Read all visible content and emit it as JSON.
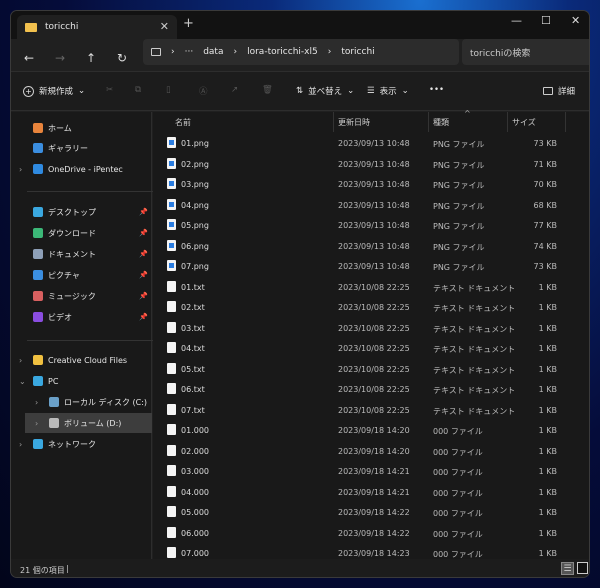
{
  "window": {
    "tab_title": "toricchi",
    "close_tab": "✕",
    "new_tab": "+",
    "minimize": "—",
    "maximize": "☐",
    "close": "✕"
  },
  "nav": {
    "back": "←",
    "forward": "→",
    "up": "↑",
    "refresh": "↻",
    "breadcrumb": [
      "data",
      "lora-toricchi-xl5",
      "toricchi"
    ],
    "more": "···",
    "sep": "›",
    "search_placeholder": "toricchiの検索"
  },
  "toolbar": {
    "new": "新規作成",
    "sort": "並べ替え",
    "view": "表示",
    "more": "•••",
    "details": "詳細"
  },
  "sidebar": {
    "quick": [
      {
        "label": "ホーム",
        "color": "#e8843c"
      },
      {
        "label": "ギャラリー",
        "color": "#3b8ee0"
      },
      {
        "label": "OneDrive - iPentec",
        "color": "#2f8ae0",
        "chev": true
      }
    ],
    "pinned": [
      {
        "label": "デスクトップ",
        "color": "#3aa8e0"
      },
      {
        "label": "ダウンロード",
        "color": "#3cb878"
      },
      {
        "label": "ドキュメント",
        "color": "#8ea0b8"
      },
      {
        "label": "ピクチャ",
        "color": "#3b8ee0"
      },
      {
        "label": "ミュージック",
        "color": "#d86060"
      },
      {
        "label": "ビデオ",
        "color": "#8a4de0"
      }
    ],
    "drives": [
      {
        "label": "Creative Cloud Files",
        "color": "#f0c040",
        "chev": "›",
        "indent": 0
      },
      {
        "label": "PC",
        "color": "#3aa8e0",
        "chev": "⌄",
        "indent": 0
      },
      {
        "label": "ローカル ディスク (C:)",
        "color": "#6aa0c8",
        "chev": "›",
        "indent": 1
      },
      {
        "label": "ボリューム (D:)",
        "color": "#bbbbbb",
        "chev": "›",
        "indent": 1,
        "selected": true
      },
      {
        "label": "ネットワーク",
        "color": "#3aa8e0",
        "chev": "›",
        "indent": 0
      }
    ],
    "pin_icon": "📌"
  },
  "columns": {
    "name": "名前",
    "date": "更新日時",
    "type": "種類",
    "size": "サイズ",
    "sort_indicator": "^"
  },
  "files": [
    {
      "name": "01.png",
      "date": "2023/09/13 10:48",
      "type": "PNG ファイル",
      "size": "73 KB",
      "kind": "png"
    },
    {
      "name": "02.png",
      "date": "2023/09/13 10:48",
      "type": "PNG ファイル",
      "size": "71 KB",
      "kind": "png"
    },
    {
      "name": "03.png",
      "date": "2023/09/13 10:48",
      "type": "PNG ファイル",
      "size": "70 KB",
      "kind": "png"
    },
    {
      "name": "04.png",
      "date": "2023/09/13 10:48",
      "type": "PNG ファイル",
      "size": "68 KB",
      "kind": "png"
    },
    {
      "name": "05.png",
      "date": "2023/09/13 10:48",
      "type": "PNG ファイル",
      "size": "77 KB",
      "kind": "png"
    },
    {
      "name": "06.png",
      "date": "2023/09/13 10:48",
      "type": "PNG ファイル",
      "size": "74 KB",
      "kind": "png"
    },
    {
      "name": "07.png",
      "date": "2023/09/13 10:48",
      "type": "PNG ファイル",
      "size": "73 KB",
      "kind": "png"
    },
    {
      "name": "01.txt",
      "date": "2023/10/08 22:25",
      "type": "テキスト ドキュメント",
      "size": "1 KB",
      "kind": "txt"
    },
    {
      "name": "02.txt",
      "date": "2023/10/08 22:25",
      "type": "テキスト ドキュメント",
      "size": "1 KB",
      "kind": "txt"
    },
    {
      "name": "03.txt",
      "date": "2023/10/08 22:25",
      "type": "テキスト ドキュメント",
      "size": "1 KB",
      "kind": "txt"
    },
    {
      "name": "04.txt",
      "date": "2023/10/08 22:25",
      "type": "テキスト ドキュメント",
      "size": "1 KB",
      "kind": "txt"
    },
    {
      "name": "05.txt",
      "date": "2023/10/08 22:25",
      "type": "テキスト ドキュメント",
      "size": "1 KB",
      "kind": "txt"
    },
    {
      "name": "06.txt",
      "date": "2023/10/08 22:25",
      "type": "テキスト ドキュメント",
      "size": "1 KB",
      "kind": "txt"
    },
    {
      "name": "07.txt",
      "date": "2023/10/08 22:25",
      "type": "テキスト ドキュメント",
      "size": "1 KB",
      "kind": "txt"
    },
    {
      "name": "01.000",
      "date": "2023/09/18 14:20",
      "type": "000 ファイル",
      "size": "1 KB",
      "kind": "000"
    },
    {
      "name": "02.000",
      "date": "2023/09/18 14:20",
      "type": "000 ファイル",
      "size": "1 KB",
      "kind": "000"
    },
    {
      "name": "03.000",
      "date": "2023/09/18 14:21",
      "type": "000 ファイル",
      "size": "1 KB",
      "kind": "000"
    },
    {
      "name": "04.000",
      "date": "2023/09/18 14:21",
      "type": "000 ファイル",
      "size": "1 KB",
      "kind": "000"
    },
    {
      "name": "05.000",
      "date": "2023/09/18 14:22",
      "type": "000 ファイル",
      "size": "1 KB",
      "kind": "000"
    },
    {
      "name": "06.000",
      "date": "2023/09/18 14:22",
      "type": "000 ファイル",
      "size": "1 KB",
      "kind": "000"
    },
    {
      "name": "07.000",
      "date": "2023/09/18 14:23",
      "type": "000 ファイル",
      "size": "1 KB",
      "kind": "000"
    }
  ],
  "status": {
    "count": "21 個の項目",
    "cursor": "|"
  }
}
